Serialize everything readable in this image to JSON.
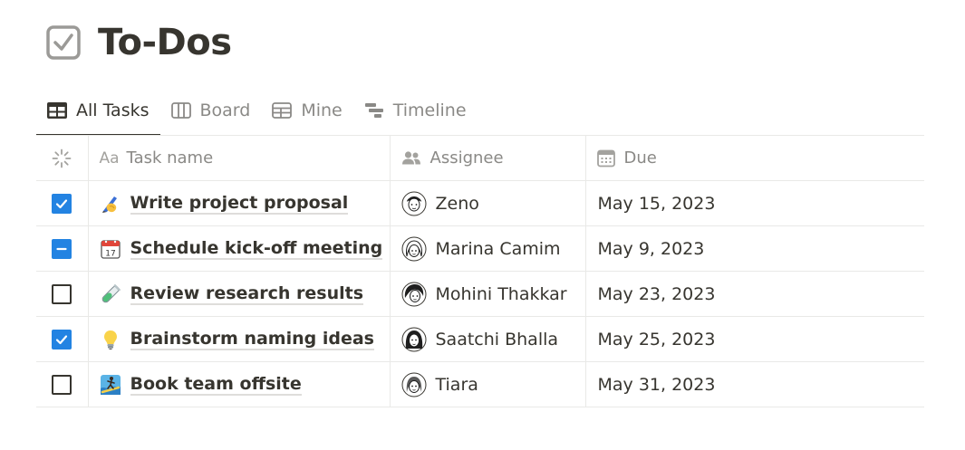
{
  "page": {
    "title": "To-Dos"
  },
  "tabs": [
    {
      "label": "All Tasks",
      "icon": "table-icon",
      "active": true
    },
    {
      "label": "Board",
      "icon": "board-icon"
    },
    {
      "label": "Mine",
      "icon": "table-icon"
    },
    {
      "label": "Timeline",
      "icon": "timeline-icon"
    }
  ],
  "columns": {
    "status": "",
    "name": "Task name",
    "name_prefix": "Aa",
    "assignee": "Assignee",
    "due": "Due"
  },
  "tasks": [
    {
      "status": "checked",
      "emoji": "writing-hand-icon",
      "name": "Write project proposal",
      "assignee": "Zeno",
      "due": "May 15, 2023"
    },
    {
      "status": "indeterminate",
      "emoji": "calendar-icon",
      "name": "Schedule kick-off meeting",
      "assignee": "Marina Camim",
      "due": "May 9, 2023"
    },
    {
      "status": "unchecked",
      "emoji": "test-tube-icon",
      "name": "Review research results",
      "assignee": "Mohini Thakkar",
      "due": "May 23, 2023"
    },
    {
      "status": "checked",
      "emoji": "light-bulb-icon",
      "name": "Brainstorm naming ideas",
      "assignee": "Saatchi Bhalla",
      "due": "May 25, 2023"
    },
    {
      "status": "unchecked",
      "emoji": "surfer-icon",
      "name": "Book team offsite",
      "assignee": "Tiara",
      "due": "May 31, 2023"
    }
  ],
  "calendar_icon_day": "17",
  "colors": {
    "accent": "#2383e2",
    "text": "#37352f",
    "muted": "#8a8986",
    "border": "#e9e9e7"
  }
}
